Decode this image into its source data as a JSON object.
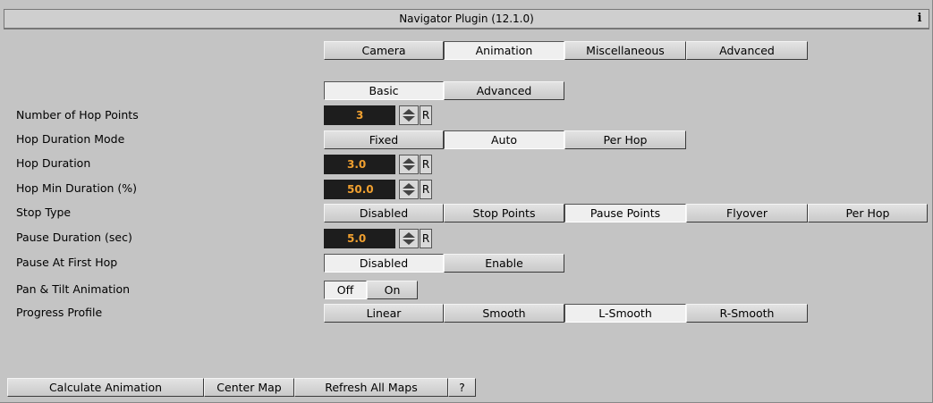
{
  "title": "Navigator Plugin (12.1.0)",
  "info_label": "i",
  "main_tabs": [
    "Camera",
    "Animation",
    "Miscellaneous",
    "Advanced"
  ],
  "sub_tabs": [
    "Basic",
    "Advanced"
  ],
  "rows": {
    "hop_points": {
      "label": "Number of Hop Points",
      "value": "3"
    },
    "hop_mode": {
      "label": "Hop Duration Mode",
      "options": [
        "Fixed",
        "Auto",
        "Per Hop"
      ]
    },
    "hop_duration": {
      "label": "Hop Duration",
      "value": "3.0"
    },
    "hop_min": {
      "label": "Hop Min Duration (%)",
      "value": "50.0"
    },
    "stop_type": {
      "label": "Stop Type",
      "options": [
        "Disabled",
        "Stop Points",
        "Pause Points",
        "Flyover",
        "Per Hop"
      ]
    },
    "pause_duration": {
      "label": "Pause Duration (sec)",
      "value": "5.0"
    },
    "pause_first": {
      "label": "Pause At First Hop",
      "options": [
        "Disabled",
        "Enable"
      ]
    },
    "pan_tilt": {
      "label": "Pan & Tilt Animation",
      "options": [
        "Off",
        "On"
      ]
    },
    "progress": {
      "label": "Progress Profile",
      "options": [
        "Linear",
        "Smooth",
        "L-Smooth",
        "R-Smooth"
      ]
    }
  },
  "reset_label": "R",
  "footer": [
    "Calculate  Animation",
    "Center Map",
    "Refresh All Maps",
    "?"
  ],
  "colors": {
    "background": "#c4c4c4",
    "number_field": "#1d1d1d",
    "number_text": "#f0a030"
  }
}
